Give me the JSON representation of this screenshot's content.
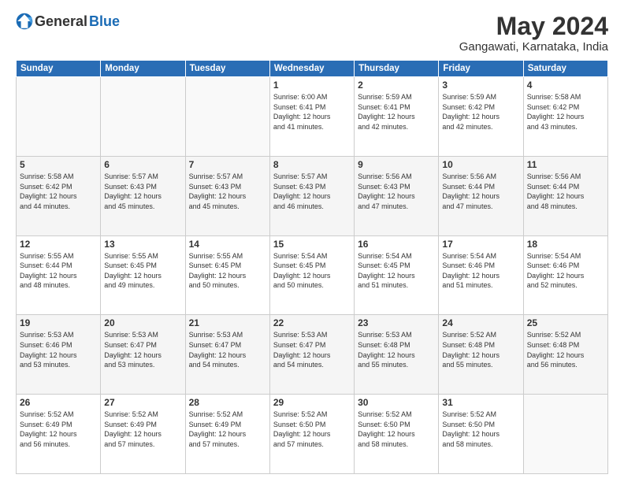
{
  "logo": {
    "general": "General",
    "blue": "Blue"
  },
  "title": "May 2024",
  "subtitle": "Gangawati, Karnataka, India",
  "headers": [
    "Sunday",
    "Monday",
    "Tuesday",
    "Wednesday",
    "Thursday",
    "Friday",
    "Saturday"
  ],
  "weeks": [
    [
      {
        "day": "",
        "info": ""
      },
      {
        "day": "",
        "info": ""
      },
      {
        "day": "",
        "info": ""
      },
      {
        "day": "1",
        "info": "Sunrise: 6:00 AM\nSunset: 6:41 PM\nDaylight: 12 hours\nand 41 minutes."
      },
      {
        "day": "2",
        "info": "Sunrise: 5:59 AM\nSunset: 6:41 PM\nDaylight: 12 hours\nand 42 minutes."
      },
      {
        "day": "3",
        "info": "Sunrise: 5:59 AM\nSunset: 6:42 PM\nDaylight: 12 hours\nand 42 minutes."
      },
      {
        "day": "4",
        "info": "Sunrise: 5:58 AM\nSunset: 6:42 PM\nDaylight: 12 hours\nand 43 minutes."
      }
    ],
    [
      {
        "day": "5",
        "info": "Sunrise: 5:58 AM\nSunset: 6:42 PM\nDaylight: 12 hours\nand 44 minutes."
      },
      {
        "day": "6",
        "info": "Sunrise: 5:57 AM\nSunset: 6:43 PM\nDaylight: 12 hours\nand 45 minutes."
      },
      {
        "day": "7",
        "info": "Sunrise: 5:57 AM\nSunset: 6:43 PM\nDaylight: 12 hours\nand 45 minutes."
      },
      {
        "day": "8",
        "info": "Sunrise: 5:57 AM\nSunset: 6:43 PM\nDaylight: 12 hours\nand 46 minutes."
      },
      {
        "day": "9",
        "info": "Sunrise: 5:56 AM\nSunset: 6:43 PM\nDaylight: 12 hours\nand 47 minutes."
      },
      {
        "day": "10",
        "info": "Sunrise: 5:56 AM\nSunset: 6:44 PM\nDaylight: 12 hours\nand 47 minutes."
      },
      {
        "day": "11",
        "info": "Sunrise: 5:56 AM\nSunset: 6:44 PM\nDaylight: 12 hours\nand 48 minutes."
      }
    ],
    [
      {
        "day": "12",
        "info": "Sunrise: 5:55 AM\nSunset: 6:44 PM\nDaylight: 12 hours\nand 48 minutes."
      },
      {
        "day": "13",
        "info": "Sunrise: 5:55 AM\nSunset: 6:45 PM\nDaylight: 12 hours\nand 49 minutes."
      },
      {
        "day": "14",
        "info": "Sunrise: 5:55 AM\nSunset: 6:45 PM\nDaylight: 12 hours\nand 50 minutes."
      },
      {
        "day": "15",
        "info": "Sunrise: 5:54 AM\nSunset: 6:45 PM\nDaylight: 12 hours\nand 50 minutes."
      },
      {
        "day": "16",
        "info": "Sunrise: 5:54 AM\nSunset: 6:45 PM\nDaylight: 12 hours\nand 51 minutes."
      },
      {
        "day": "17",
        "info": "Sunrise: 5:54 AM\nSunset: 6:46 PM\nDaylight: 12 hours\nand 51 minutes."
      },
      {
        "day": "18",
        "info": "Sunrise: 5:54 AM\nSunset: 6:46 PM\nDaylight: 12 hours\nand 52 minutes."
      }
    ],
    [
      {
        "day": "19",
        "info": "Sunrise: 5:53 AM\nSunset: 6:46 PM\nDaylight: 12 hours\nand 53 minutes."
      },
      {
        "day": "20",
        "info": "Sunrise: 5:53 AM\nSunset: 6:47 PM\nDaylight: 12 hours\nand 53 minutes."
      },
      {
        "day": "21",
        "info": "Sunrise: 5:53 AM\nSunset: 6:47 PM\nDaylight: 12 hours\nand 54 minutes."
      },
      {
        "day": "22",
        "info": "Sunrise: 5:53 AM\nSunset: 6:47 PM\nDaylight: 12 hours\nand 54 minutes."
      },
      {
        "day": "23",
        "info": "Sunrise: 5:53 AM\nSunset: 6:48 PM\nDaylight: 12 hours\nand 55 minutes."
      },
      {
        "day": "24",
        "info": "Sunrise: 5:52 AM\nSunset: 6:48 PM\nDaylight: 12 hours\nand 55 minutes."
      },
      {
        "day": "25",
        "info": "Sunrise: 5:52 AM\nSunset: 6:48 PM\nDaylight: 12 hours\nand 56 minutes."
      }
    ],
    [
      {
        "day": "26",
        "info": "Sunrise: 5:52 AM\nSunset: 6:49 PM\nDaylight: 12 hours\nand 56 minutes."
      },
      {
        "day": "27",
        "info": "Sunrise: 5:52 AM\nSunset: 6:49 PM\nDaylight: 12 hours\nand 57 minutes."
      },
      {
        "day": "28",
        "info": "Sunrise: 5:52 AM\nSunset: 6:49 PM\nDaylight: 12 hours\nand 57 minutes."
      },
      {
        "day": "29",
        "info": "Sunrise: 5:52 AM\nSunset: 6:50 PM\nDaylight: 12 hours\nand 57 minutes."
      },
      {
        "day": "30",
        "info": "Sunrise: 5:52 AM\nSunset: 6:50 PM\nDaylight: 12 hours\nand 58 minutes."
      },
      {
        "day": "31",
        "info": "Sunrise: 5:52 AM\nSunset: 6:50 PM\nDaylight: 12 hours\nand 58 minutes."
      },
      {
        "day": "",
        "info": ""
      }
    ]
  ]
}
